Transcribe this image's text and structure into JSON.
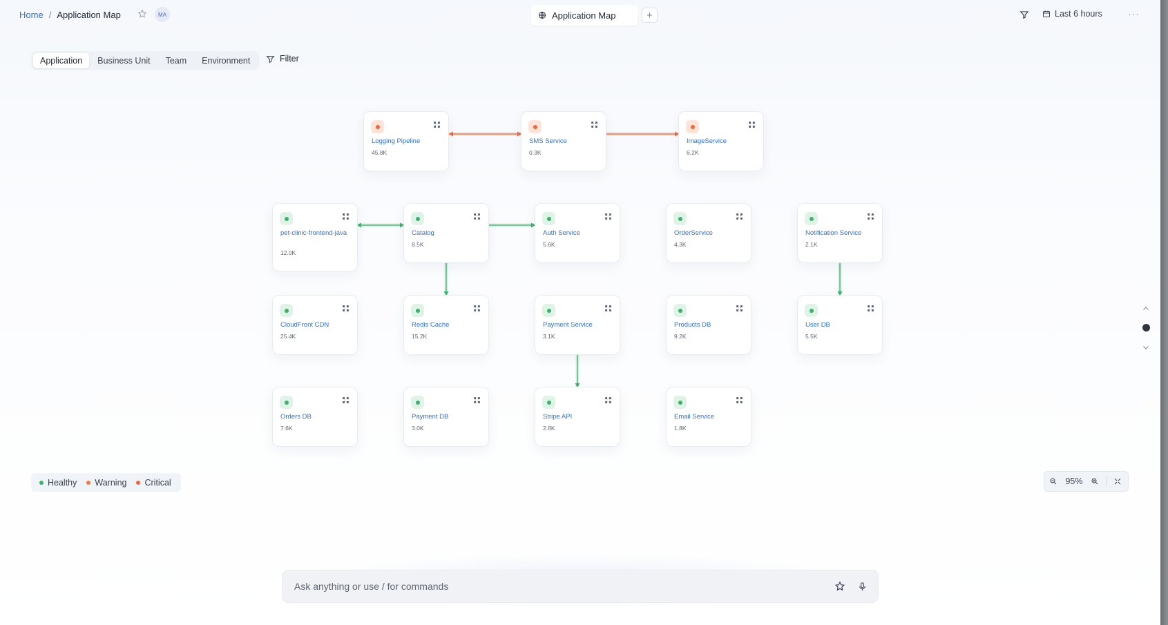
{
  "breadcrumb": {
    "home": "Home",
    "separator": "/",
    "current": "Application Map"
  },
  "avatar": {
    "initials": "MA"
  },
  "tab": {
    "label": "Application Map",
    "icon": "globe-icon",
    "add_label": "+"
  },
  "header": {
    "time_range": "Last 6 hours",
    "more": "···"
  },
  "segments": [
    "Application",
    "Business Unit",
    "Team",
    "Environment"
  ],
  "filter_label": "Filter",
  "colors": {
    "healthy": "#3bb26b",
    "warning": "#f07a4a",
    "critical": "#f0663a",
    "link": "#2f6fe0"
  },
  "nodes": [
    {
      "id": "logging",
      "name": "Logging Pipeline",
      "value": "45.8K",
      "status": "critical"
    },
    {
      "id": "sms",
      "name": "SMS Service",
      "value": "0.3K",
      "status": "critical"
    },
    {
      "id": "image",
      "name": "ImageService",
      "value": "6.2K",
      "status": "critical"
    },
    {
      "id": "petclinic",
      "name": "pet-clinic-frontend-java",
      "value": "12.0K",
      "status": "healthy"
    },
    {
      "id": "catalog",
      "name": "Catalog",
      "value": "8.5K",
      "status": "healthy"
    },
    {
      "id": "auth",
      "name": "Auth Service",
      "value": "5.6K",
      "status": "healthy"
    },
    {
      "id": "order",
      "name": "OrderService",
      "value": "4.3K",
      "status": "healthy"
    },
    {
      "id": "notification",
      "name": "Notification Service",
      "value": "2.1K",
      "status": "healthy"
    },
    {
      "id": "cloudfront",
      "name": "CloudFront CDN",
      "value": "25.4K",
      "status": "healthy"
    },
    {
      "id": "redis",
      "name": "Redis Cache",
      "value": "15.2K",
      "status": "healthy"
    },
    {
      "id": "payment",
      "name": "Payment Service",
      "value": "3.1K",
      "status": "healthy"
    },
    {
      "id": "productsdb",
      "name": "Products DB",
      "value": "9.2K",
      "status": "healthy"
    },
    {
      "id": "userdb",
      "name": "User DB",
      "value": "5.5K",
      "status": "healthy"
    },
    {
      "id": "ordersdb",
      "name": "Orders DB",
      "value": "7.6K",
      "status": "healthy"
    },
    {
      "id": "paymentdb",
      "name": "Payment DB",
      "value": "3.0K",
      "status": "healthy"
    },
    {
      "id": "stripe",
      "name": "Stripe API",
      "value": "2.8K",
      "status": "healthy"
    },
    {
      "id": "email",
      "name": "Email Service",
      "value": "1.8K",
      "status": "healthy"
    }
  ],
  "legend": [
    {
      "label": "Healthy",
      "status": "healthy"
    },
    {
      "label": "Warning",
      "status": "warning"
    },
    {
      "label": "Critical",
      "status": "critical"
    }
  ],
  "zoom": {
    "value": "95%"
  },
  "ask": {
    "placeholder": "Ask anything or use / for commands"
  }
}
